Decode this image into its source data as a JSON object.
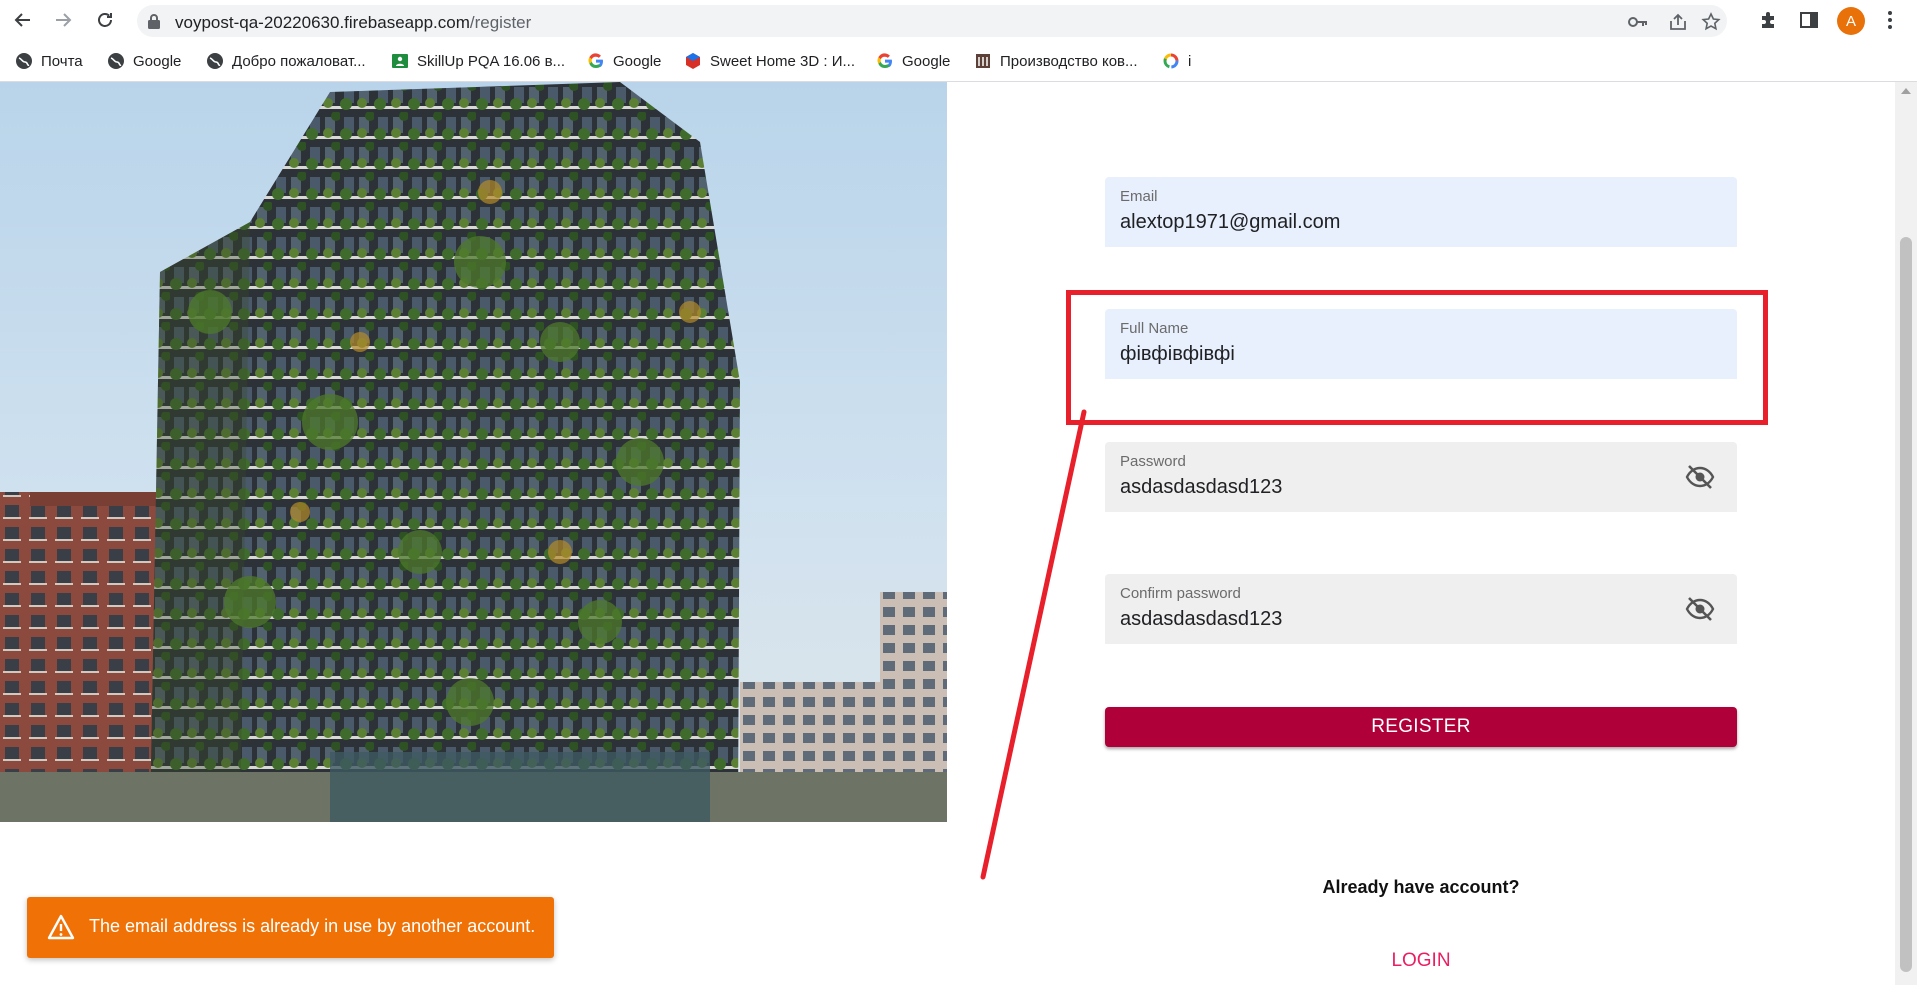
{
  "browser": {
    "url_host": "voypost-qa-20220630.firebaseapp.com",
    "url_path": "/register",
    "avatar_letter": "A",
    "accent_color": "#e8710a"
  },
  "bookmarks": [
    {
      "label": "Почта",
      "icon": "globe-icon"
    },
    {
      "label": "Google",
      "icon": "globe-icon"
    },
    {
      "label": "Добро пожаловат...",
      "icon": "globe-icon"
    },
    {
      "label": "SkillUp PQA 16.06 в...",
      "icon": "classroom-icon"
    },
    {
      "label": "Google",
      "icon": "google-icon"
    },
    {
      "label": "Sweet Home 3D : И...",
      "icon": "sweethome-icon"
    },
    {
      "label": "Google",
      "icon": "google-icon"
    },
    {
      "label": "Производство ков...",
      "icon": "site-icon"
    },
    {
      "label": "i",
      "icon": "colorful-ring-icon"
    }
  ],
  "form": {
    "email": {
      "label": "Email",
      "value": "alextop1971@gmail.com"
    },
    "full_name": {
      "label": "Full Name",
      "value": "фівфівфівфі"
    },
    "password": {
      "label": "Password",
      "value": "asdasdasdasd123"
    },
    "confirm_password": {
      "label": "Confirm password",
      "value": "asdasdasdasd123"
    },
    "register_label": "REGISTER",
    "already_text": "Already have account?",
    "login_label": "LOGIN",
    "primary_color": "#b0003a",
    "link_color": "#e91e63"
  },
  "toast": {
    "message": "The email address is already in use by another account.",
    "icon": "warning-icon",
    "color": "#f07206"
  },
  "annotation": {
    "color": "#e8202b"
  }
}
